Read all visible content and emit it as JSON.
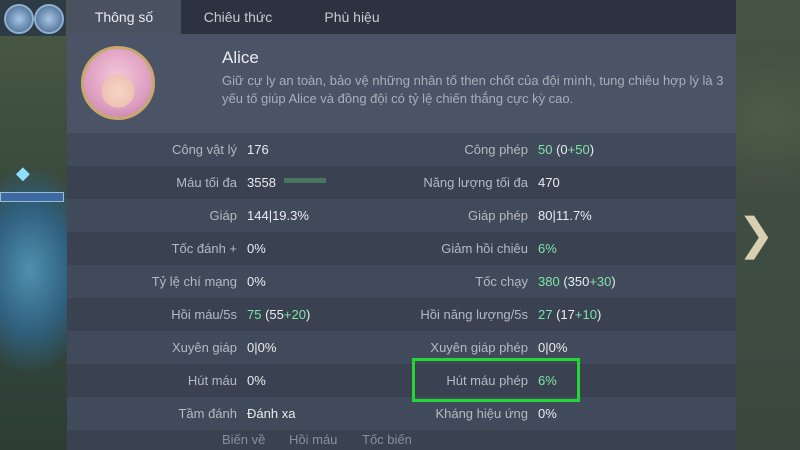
{
  "tabs": [
    {
      "label": "Thông số",
      "active": true
    },
    {
      "label": "Chiêu thức",
      "active": false
    },
    {
      "label": "Phù hiệu",
      "active": false
    }
  ],
  "hero": {
    "name": "Alice",
    "description": "Giữ cự ly an toàn, bảo vệ những nhân tố then chốt của đội mình, tung chiêu hợp lý là 3 yếu tố giúp Alice và đồng đội có tỷ lệ chiến thắng cực kỳ cao."
  },
  "stats": {
    "left": [
      {
        "label": "Công vật lý",
        "value": "176"
      },
      {
        "label": "Máu tối đa",
        "value": "3558"
      },
      {
        "label": "Giáp",
        "value": "144|19.3%"
      },
      {
        "label": "Tốc đánh +",
        "value": "0%"
      },
      {
        "label": "Tỷ lệ chí mạng",
        "value": "0%"
      },
      {
        "label": "Hồi máu/5s",
        "value_main": "75",
        "value_open": " (55",
        "value_bonus": "+20",
        "value_close": ")"
      },
      {
        "label": "Xuyên giáp",
        "value": "0|0%"
      },
      {
        "label": "Hút máu",
        "value": "0%"
      },
      {
        "label": "Tầm đánh",
        "value": "Đánh xa"
      }
    ],
    "right": [
      {
        "label": "Công phép",
        "value_main": "50",
        "value_open": " (0",
        "value_bonus": "+50",
        "value_close": ")"
      },
      {
        "label": "Năng lượng tối đa",
        "value": "470"
      },
      {
        "label": "Giáp phép",
        "value": "80|11.7%"
      },
      {
        "label": "Giảm hồi chiêu",
        "value": "6%"
      },
      {
        "label": "Tốc chạy",
        "value_main": "380",
        "value_open": " (350",
        "value_bonus": "+30",
        "value_close": ")"
      },
      {
        "label": "Hồi năng lượng/5s",
        "value_main": "27",
        "value_open": " (17",
        "value_bonus": "+10",
        "value_close": ")"
      },
      {
        "label": "Xuyên giáp phép",
        "value": "0|0%"
      },
      {
        "label": "Hút máu phép",
        "value": "6%"
      },
      {
        "label": "Kháng hiệu ứng",
        "value": "0%"
      }
    ]
  },
  "bottom_skills": [
    "Biến về",
    "Hồi máu",
    "Tốc biến"
  ],
  "colors": {
    "accent_green": "#7fe3a8",
    "highlight_border": "#23d634"
  }
}
